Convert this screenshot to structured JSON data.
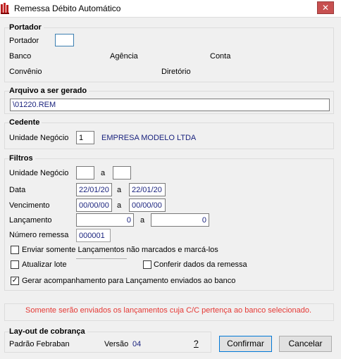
{
  "window": {
    "title": "Remessa Débito Automático",
    "close_glyph": "✕",
    "icon": "app-icon"
  },
  "portador": {
    "group_title": "Portador",
    "portador_label": "Portador",
    "portador_value": "",
    "banco_label": "Banco",
    "agencia_label": "Agência",
    "conta_label": "Conta",
    "convenio_label": "Convênio",
    "diretorio_label": "Diretório"
  },
  "arquivo": {
    "group_title": "Arquivo a ser gerado",
    "value": "\\01220.REM"
  },
  "cedente": {
    "group_title": "Cedente",
    "unidade_label": "Unidade Negócio",
    "unidade_value": "1",
    "empresa_name": "EMPRESA MODELO LTDA"
  },
  "filtros": {
    "group_title": "Filtros",
    "unidade_label": "Unidade Negócio",
    "unidade_from": "",
    "unidade_to": "",
    "a_label": "a",
    "data_label": "Data",
    "data_from": "22/01/20",
    "data_to": "22/01/20",
    "vencimento_label": "Vencimento",
    "vencimento_from": "00/00/00",
    "vencimento_to": "00/00/00",
    "lancamento_label": "Lançamento",
    "lancamento_from": "0",
    "lancamento_to": "0",
    "numero_remessa_label": "Número remessa",
    "numero_remessa_value": "000001",
    "chk_enviar_label": "Enviar somente Lançamentos não marcados e marcá-los",
    "chk_enviar_checked": false,
    "chk_atualizar_label": "Atualizar lote",
    "chk_atualizar_checked": false,
    "chk_conferir_label": "Conferir dados da remessa",
    "chk_conferir_checked": false,
    "chk_gerar_label": "Gerar acompanhamento para Lançamento enviados ao banco",
    "chk_gerar_checked": true,
    "check_glyph": "✓"
  },
  "warning_text": "Somente serão enviados os lançamentos cuja C/C pertença ao banco selecionado.",
  "layout_cobranca": {
    "group_title": "Lay-out de cobrança",
    "padrao_text": "Padrão Febraban",
    "versao_label": "Versão",
    "versao_value": "04",
    "help_text": "?"
  },
  "buttons": {
    "confirm_label": "Confirmar",
    "cancel_label": "Cancelar"
  },
  "colors": {
    "accent": "#1a237e",
    "warning": "#e53935",
    "close": "#c75050"
  }
}
